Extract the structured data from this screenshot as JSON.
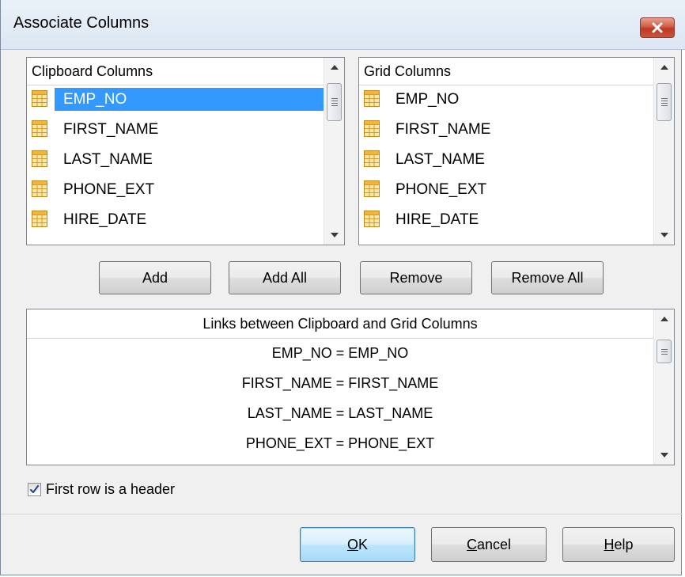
{
  "window": {
    "title": "Associate Columns"
  },
  "clipboard_columns": {
    "header": "Clipboard Columns",
    "items": [
      "EMP_NO",
      "FIRST_NAME",
      "LAST_NAME",
      "PHONE_EXT",
      "HIRE_DATE"
    ],
    "selected": "EMP_NO"
  },
  "grid_columns": {
    "header": "Grid Columns",
    "items": [
      "EMP_NO",
      "FIRST_NAME",
      "LAST_NAME",
      "PHONE_EXT",
      "HIRE_DATE"
    ]
  },
  "actions": {
    "add": "Add",
    "add_all": "Add All",
    "remove": "Remove",
    "remove_all": "Remove All"
  },
  "links": {
    "header": "Links between Clipboard and Grid Columns",
    "items": [
      "EMP_NO = EMP_NO",
      "FIRST_NAME = FIRST_NAME",
      "LAST_NAME = LAST_NAME",
      "PHONE_EXT = PHONE_EXT"
    ]
  },
  "options": {
    "first_row_header_label": "First row is a header",
    "first_row_header_checked": true
  },
  "footer": {
    "ok_mnemonic": "O",
    "ok_rest": "K",
    "cancel_mnemonic": "C",
    "cancel_rest": "ancel",
    "help_mnemonic": "H",
    "help_rest": "elp"
  },
  "icons": {
    "close": "close-icon",
    "table": "table-icon",
    "scroll_up": "arrow-up-icon",
    "scroll_down": "arrow-down-icon",
    "check": "checkmark-icon"
  },
  "colors": {
    "selection": "#3399ff",
    "close_button": "#c9533b",
    "default_button_border": "#3c7fb1"
  }
}
